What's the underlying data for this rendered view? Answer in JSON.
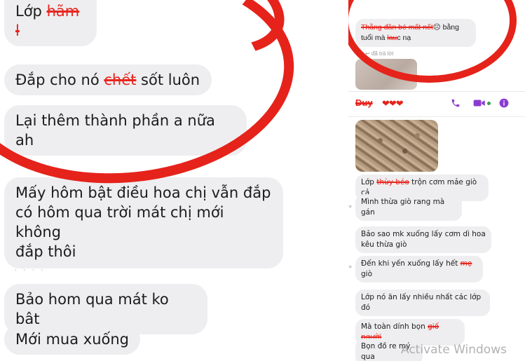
{
  "left_chat": {
    "m1": {
      "pre": "Lớp ",
      "struck": "hãm l"
    },
    "m2": {
      "pre": "Đắp cho nó ",
      "struck": "chết",
      "post": " sốt luôn"
    },
    "m3": "Lại thêm thành phần a nữa ah",
    "m4_l1": "Mấy hôm bật điều hoa chị vẫn đắp",
    "m4_l2": "có hôm qua trời mát chị mới không",
    "m4_l3": "đắp thôi",
    "m5": "Bảo hom qua mát ko bật",
    "m6": "Mới mua xuống",
    "dots": "· · · ·"
  },
  "right_top": {
    "msg_struck": "Thằng đần bé mất nết",
    "msg_emoji": "☹",
    "msg_post1": " bằng",
    "msg_l2_pre": "tuổi mà ",
    "msg_l2_struck": "lau",
    "msg_l2_post": "c nạ",
    "reply_label": "↩ đã trả lời"
  },
  "right_bottom": {
    "contact_name": "Duy",
    "hearts": "❤❤❤",
    "messages": {
      "b1_pre": "Lớp ",
      "b1_struck": "thùy béo",
      "b1_post": " trộn cơm mảe giò cả",
      "b2": "Mình thừa giò rang mà gán",
      "b3_l1": "Bảo sao mk xuống lấy cơm dì hoa",
      "b3_l2": "kêu thừa giò",
      "b4_pre": "Đến khi yến xuống lấy hết ",
      "b4_struck": "mẹ",
      "b4_post": " giò",
      "b5_l1": "Lớp nó ăn lấy nhiều nhất các lớp",
      "b5_l2": "đó",
      "b6_pre": "Mà toàn dính bọn ",
      "b6_struck": "giố người",
      "b7": "Bọn đồ re mý qua"
    }
  },
  "watermark": "Activate Windows",
  "colors": {
    "annotation_red": "#e5231b",
    "bubble_gray": "#eeeef0",
    "messenger_purple": "#8a3ccf"
  }
}
